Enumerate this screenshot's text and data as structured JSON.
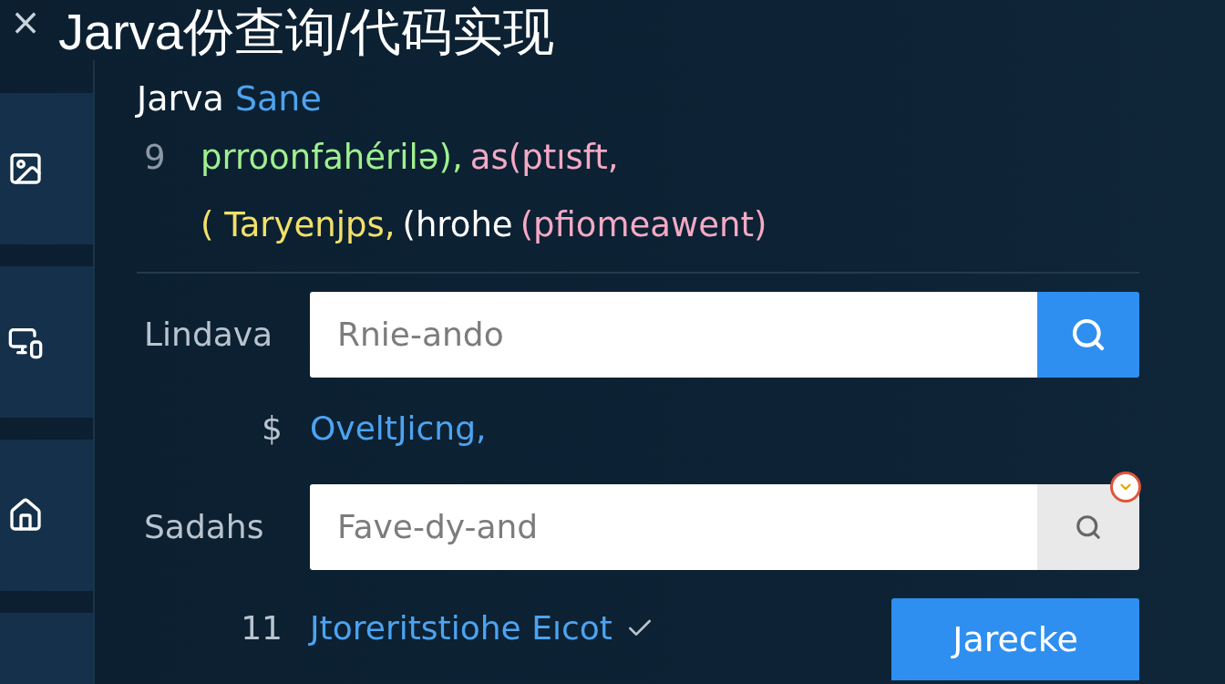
{
  "window": {
    "close": "×",
    "title": "Jarva份查询/代码实现"
  },
  "sidebar": {
    "items": [
      {
        "kind": "image"
      },
      {
        "kind": "devices"
      },
      {
        "kind": "home"
      },
      {
        "kind": "blank"
      }
    ]
  },
  "editor": {
    "heading": [
      {
        "text": "Jarva",
        "color": "#ffffff"
      },
      {
        "text": "Sane",
        "color": "#4da3f0"
      }
    ],
    "lines": [
      {
        "number": "9",
        "segments": [
          {
            "text": "prroonfahérilə),",
            "color": "#9ff08f"
          },
          {
            "text": "as(ptısft,",
            "color": "#f4a9c4"
          }
        ]
      },
      {
        "segments": [
          {
            "text": "( Taryenjps,",
            "color": "#f2e06a"
          },
          {
            "text": "(hrohe",
            "color": "#ffffff"
          },
          {
            "text": "(pfiomeawent)",
            "color": "#f4a9c4"
          }
        ]
      }
    ]
  },
  "form": {
    "rows": [
      {
        "kind": "search",
        "label": "Lindava",
        "placeholder": "Rnie-ando",
        "highlighted": true
      },
      {
        "kind": "link",
        "label": "$",
        "text": "OveltJicng,"
      },
      {
        "kind": "search",
        "label": "Sadahs",
        "placeholder": "Fave-dy-and",
        "highlighted": false,
        "badge": true
      },
      {
        "kind": "action",
        "label": "11",
        "text": "Jtoreritstiohe Eıcot",
        "checked": true,
        "button": "Jarecke"
      }
    ]
  }
}
